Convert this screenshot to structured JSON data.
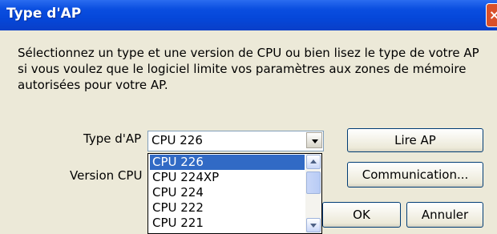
{
  "window": {
    "title": "Type d'AP"
  },
  "description": "Sélectionnez un type et une version de CPU ou bien lisez le type de votre AP si vous voulez que le logiciel limite vos paramètres aux zones de mémoire autorisées pour votre AP.",
  "form": {
    "type_label": "Type d'AP",
    "type_value": "CPU 226",
    "version_label": "Version CPU"
  },
  "dropdown": {
    "options": [
      "CPU 226",
      "CPU 224XP",
      "CPU 224",
      "CPU 222",
      "CPU 221"
    ],
    "selected_index": 0
  },
  "buttons": {
    "read": "Lire AP",
    "communication": "Communication...",
    "ok": "OK",
    "cancel": "Annuler"
  },
  "colors": {
    "titlebar": "#0a4ee0",
    "selection": "#316ac5"
  }
}
